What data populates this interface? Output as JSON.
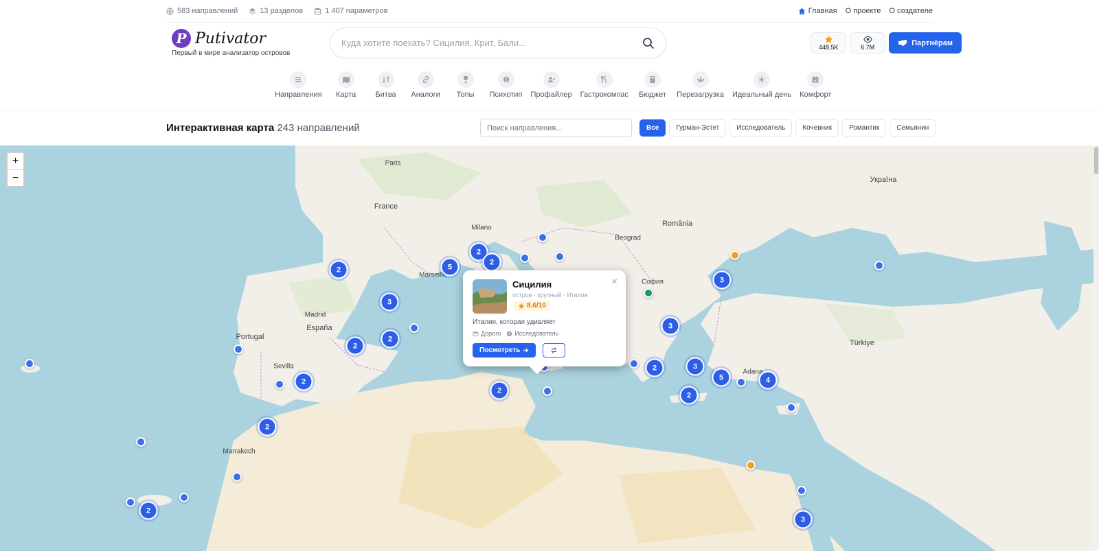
{
  "topbar": {
    "stats": [
      {
        "icon": "globe-icon",
        "text": "583 направлений"
      },
      {
        "icon": "layers-icon",
        "text": "13 разделов"
      },
      {
        "icon": "database-icon",
        "text": "1 407 параметров"
      }
    ],
    "links": [
      {
        "icon": "home-icon",
        "text": "Главная"
      },
      {
        "text": "О проекте"
      },
      {
        "text": "О создателе"
      }
    ]
  },
  "header": {
    "logo_mark": "P",
    "logo_text": "Putivator",
    "logo_sub": "Первый в мире анализатор островов",
    "search_placeholder": "Куда хотите поехать? Сицилия, Крит, Бали...",
    "rating_count": "448.5K",
    "views_count": "6.7M",
    "partner_label": "Партнёрам"
  },
  "nav": [
    {
      "icon": "list-icon",
      "label": "Направления"
    },
    {
      "icon": "map-icon",
      "label": "Карта"
    },
    {
      "icon": "swap-icon",
      "label": "Битва"
    },
    {
      "icon": "link-icon",
      "label": "Аналоги"
    },
    {
      "icon": "trophy-icon",
      "label": "Топы"
    },
    {
      "icon": "brain-icon",
      "label": "Психотип"
    },
    {
      "icon": "user-check-icon",
      "label": "Профайлер"
    },
    {
      "icon": "utensils-icon",
      "label": "Гастрокомпас"
    },
    {
      "icon": "calculator-icon",
      "label": "Бюджет"
    },
    {
      "icon": "lotus-icon",
      "label": "Перезагрузка"
    },
    {
      "icon": "sun-icon",
      "label": "Идеальный день"
    },
    {
      "icon": "calendar-icon",
      "label": "Комфорт"
    }
  ],
  "map_section": {
    "title": "Интерактивная карта",
    "count": "243 направлений",
    "search_placeholder": "Поиск направления...",
    "filters": [
      "Все",
      "Гурман-Эстет",
      "Исследователь",
      "Кочевник",
      "Романтик",
      "Семьянин"
    ],
    "active_filter": "Все"
  },
  "zoom": {
    "in": "+",
    "out": "−"
  },
  "clusters": [
    "2",
    "5",
    "2",
    "2",
    "3",
    "2",
    "2",
    "2",
    "2",
    "2",
    "3",
    "3",
    "2",
    "3",
    "5",
    "4",
    "2",
    "3",
    "2"
  ],
  "map_labels": [
    "Paris",
    "Madrid",
    "España",
    "France",
    "Portugal",
    "Marseille",
    "România",
    "Türkiye",
    "Україна",
    "София",
    "Sevilla",
    "Marrakech",
    "Adana",
    "Beograd",
    "Milano"
  ],
  "popup": {
    "name": "Сицилия",
    "meta": "остров · крупный · Италия",
    "rating": "8.6/10",
    "description": "Италия, которая удивляет",
    "tags": [
      {
        "icon": "coins-icon",
        "text": "Дорого"
      },
      {
        "icon": "compass-icon",
        "text": "Исследователь"
      }
    ],
    "view_label": "Посмотреть",
    "close": "×"
  },
  "colors": {
    "primary": "#2563eb",
    "cluster": "#2e5ee6",
    "accent_orange": "#f2a024",
    "accent_green": "#1a9a6c",
    "brand_purple": "#6d3fbf",
    "sea": "#aad3df",
    "land": "#f2efe9"
  }
}
